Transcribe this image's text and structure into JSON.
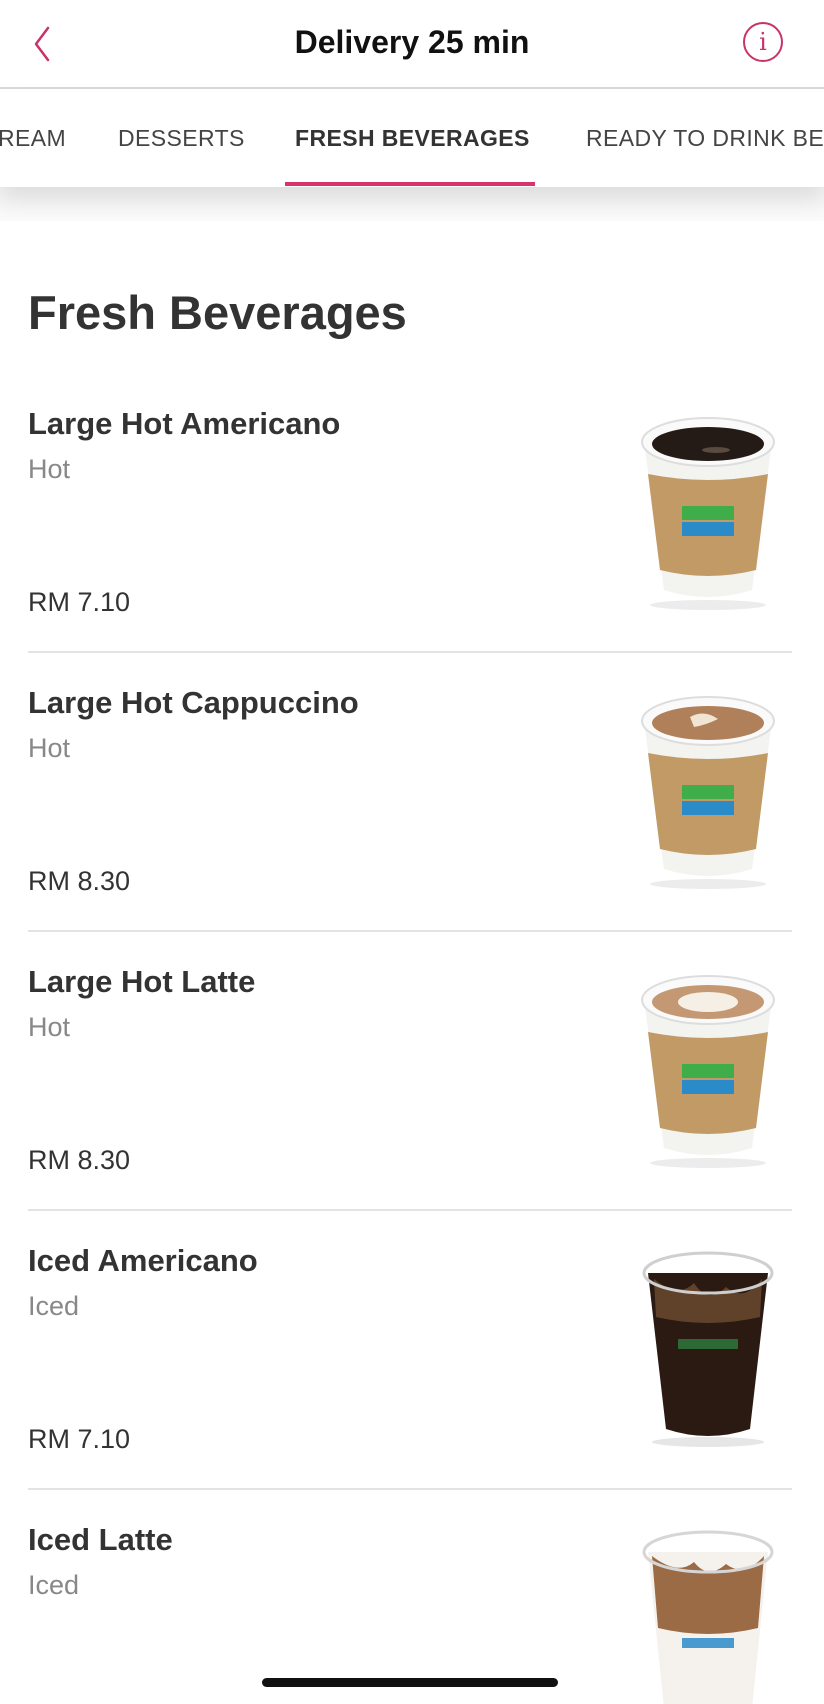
{
  "header": {
    "title": "Delivery 25 min"
  },
  "tabs": [
    {
      "label": "REAM"
    },
    {
      "label": "DESSERTS"
    },
    {
      "label": "FRESH BEVERAGES",
      "active": true
    },
    {
      "label": "READY TO DRINK BEV"
    }
  ],
  "section": {
    "title": "Fresh Beverages"
  },
  "items": [
    {
      "name": "Large Hot Americano",
      "variant": "Hot",
      "price": "RM 7.10",
      "image": "hot-americano-cup"
    },
    {
      "name": "Large Hot Cappuccino",
      "variant": "Hot",
      "price": "RM 8.30",
      "image": "hot-cappuccino-cup"
    },
    {
      "name": "Large Hot Latte",
      "variant": "Hot",
      "price": "RM 8.30",
      "image": "hot-latte-cup"
    },
    {
      "name": "Iced Americano",
      "variant": "Iced",
      "price": "RM 7.10",
      "image": "iced-americano-cup"
    },
    {
      "name": "Iced Latte",
      "variant": "Iced",
      "price": "",
      "image": "iced-latte-cup"
    }
  ],
  "colors": {
    "accent": "#d8336b",
    "text": "#333333",
    "muted": "#888888"
  }
}
